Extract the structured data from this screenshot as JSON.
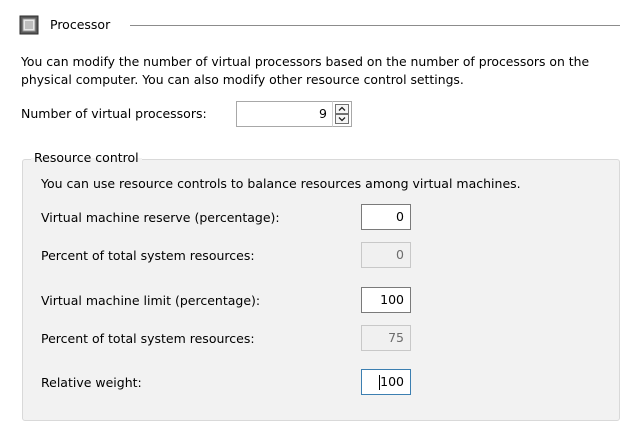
{
  "header": {
    "title": "Processor",
    "icon": "processor-chip-icon"
  },
  "description": "You can modify the number of virtual processors based on the number of processors on the physical computer. You can also modify other resource control settings.",
  "virtual_processors": {
    "label": "Number of virtual processors:",
    "value": "9"
  },
  "resource_control": {
    "title": "Resource control",
    "description": "You can use resource controls to balance resources among virtual machines.",
    "reserve": {
      "label": "Virtual machine reserve (percentage):",
      "value": "0"
    },
    "reserve_total": {
      "label": "Percent of total system resources:",
      "value": "0"
    },
    "limit": {
      "label": "Virtual machine limit (percentage):",
      "value": "100"
    },
    "limit_total": {
      "label": "Percent of total system resources:",
      "value": "75"
    },
    "weight": {
      "label": "Relative weight:",
      "value": "100"
    }
  },
  "colors": {
    "group_background": "#f2f2f2",
    "focus_border": "#3c7fb1",
    "readonly_text": "#6d6d6d"
  }
}
